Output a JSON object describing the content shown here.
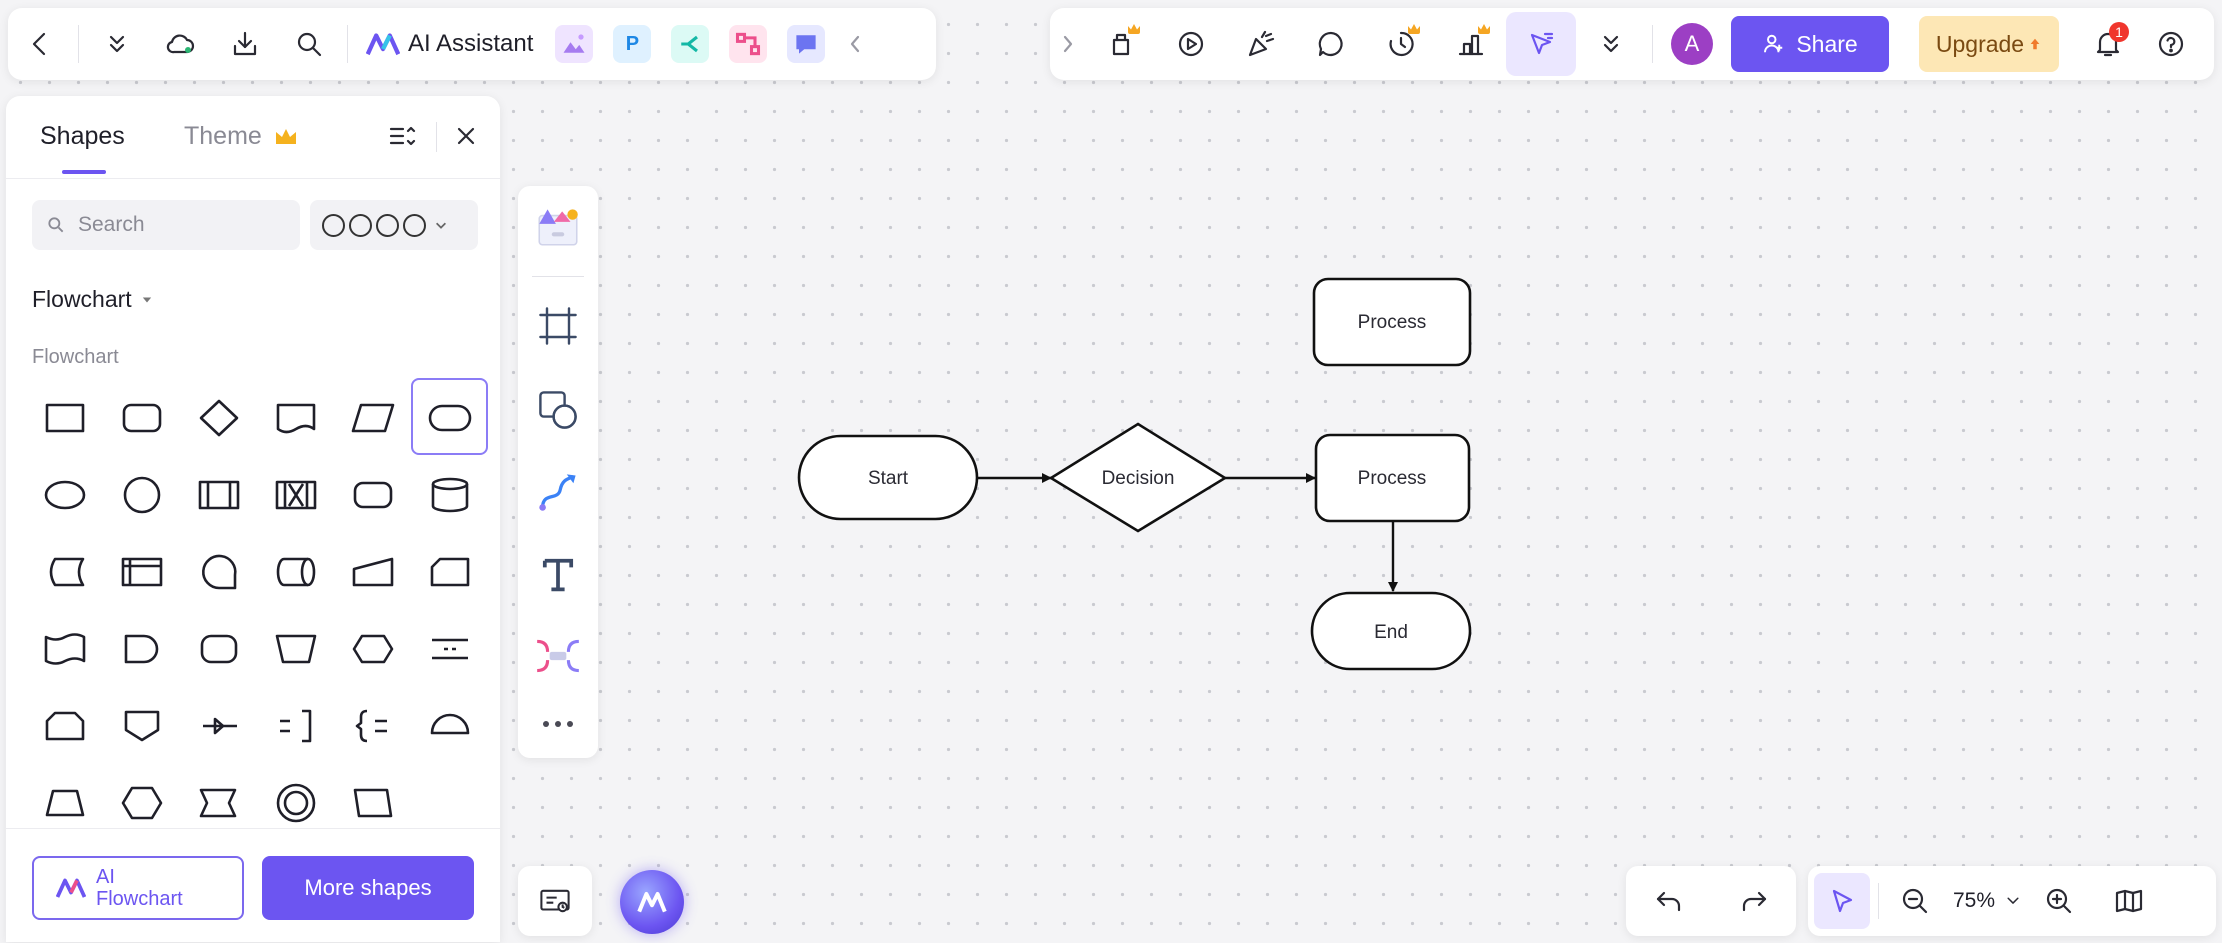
{
  "toolbar_left": {
    "ai_assistant_label": "AI Assistant",
    "app_icons": [
      "image-ai-icon",
      "presentation-p-icon",
      "mindmap-icon",
      "flowchart-app-icon",
      "chat-icon"
    ]
  },
  "toolbar_right": {
    "avatar_initial": "A",
    "share_label": "Share",
    "upgrade_label": "Upgrade",
    "notification_count": "1"
  },
  "panel": {
    "tabs": [
      {
        "label": "Shapes"
      },
      {
        "label": "Theme"
      }
    ],
    "search_placeholder": "Search",
    "category": "Flowchart",
    "subcategory": "Flowchart",
    "ai_flowchart_label_1": "AI",
    "ai_flowchart_label_2": "Flowchart",
    "more_shapes_label": "More shapes"
  },
  "diagram": {
    "nodes": [
      {
        "id": "start",
        "label": "Start",
        "shape": "terminator"
      },
      {
        "id": "decision",
        "label": "Decision",
        "shape": "diamond"
      },
      {
        "id": "process1",
        "label": "Process",
        "shape": "rounded-rect"
      },
      {
        "id": "process2",
        "label": "Process",
        "shape": "rounded-rect"
      },
      {
        "id": "end",
        "label": "End",
        "shape": "terminator"
      }
    ],
    "edges": [
      {
        "from": "start",
        "to": "decision"
      },
      {
        "from": "decision",
        "to": "process2"
      },
      {
        "from": "process2",
        "to": "end"
      }
    ]
  },
  "zoom": {
    "level": "75%"
  },
  "colors": {
    "accent": "#6c55f1",
    "upgrade_bg": "#fde7b5",
    "avatar": "#9c3fc4",
    "badge": "#f0362d"
  }
}
